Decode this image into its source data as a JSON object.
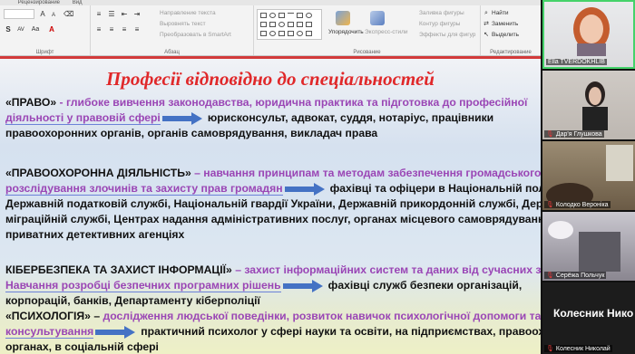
{
  "ribbon": {
    "tabs": [
      "",
      "Рецензирование",
      "Вид"
    ],
    "groups": {
      "font_label": "Шрифт",
      "paragraph_label": "Абзац",
      "drawing_label": "Рисование",
      "editing_label": "Редактирование"
    },
    "paragraph_items": {
      "text_direction": "Направление текста",
      "align_text": "Выровнять текст",
      "smartart": "Преобразовать в SmartArt"
    },
    "drawing_items": {
      "arrange": "Упорядочить",
      "quick_styles": "Экспресс-стили",
      "shape_fill": "Заливка фигуры",
      "shape_outline": "Контур фигуры",
      "shape_effects": "Эффекты для фигур"
    },
    "editing_items": {
      "find": "Найти",
      "replace": "Заменить",
      "select": "Выделить"
    }
  },
  "slide": {
    "title": "Професії відповідно до спеціальностей",
    "sections": [
      {
        "lines": [
          [
            {
              "t": "«ПРАВО»",
              "c": "head"
            },
            {
              "t": " - глибоке вивчення законодавства, юридична практика та підготовка до професійної",
              "c": "purple"
            }
          ],
          [
            {
              "t": "діяльності у правовій сфері",
              "c": "purple uline"
            },
            {
              "arrow": true
            },
            {
              "t": "юрисконсульт, адвокат, суддя, нотаріус, працівники",
              "c": "blk"
            }
          ],
          [
            {
              "t": "правоохоронних органів, органів самоврядування, викладач права",
              "c": "blk"
            }
          ]
        ]
      },
      {
        "lines": [
          [
            {
              "t": "«ПРАВООХОРОННА ДІЯЛЬНІСТЬ»",
              "c": "head"
            },
            {
              "t": " – навчання принципам та методам забезпечення громадського поряд",
              "c": "purple"
            }
          ],
          [
            {
              "t": "розслідування злочинів та захисту прав громадян",
              "c": "purple uline"
            },
            {
              "arrow": true
            },
            {
              "t": "фахівці та офіцери в Національній поліції Украї",
              "c": "blk"
            }
          ],
          [
            {
              "t": "Державній податковій службі, Національній гвардії України, Державній прикордонній службі,  Держав",
              "c": "blk"
            }
          ],
          [
            {
              "t": "міграційній службі, Центрах надання адміністративних послуг, органах місцевого самоврядування,",
              "c": "blk"
            }
          ],
          [
            {
              "t": "приватних детективних агенціях",
              "c": "blk"
            }
          ]
        ]
      },
      {
        "lines": [
          [
            {
              "t": "КІБЕРБЕЗПЕКА ТА ЗАХИСТ ІНФОРМАЦІЇ»",
              "c": "head"
            },
            {
              "t": " – захист інформаційних систем та даних від сучасних загроз.",
              "c": "purple"
            }
          ],
          [
            {
              "t": "Навчання розробці безпечних програмних рішень",
              "c": "purple uline"
            },
            {
              "arrow": true
            },
            {
              "t": "фахівці служб безпеки організацій,",
              "c": "blk"
            }
          ],
          [
            {
              "t": "корпорацій, банків, Департаменту кіберполіції",
              "c": "blk"
            }
          ]
        ]
      },
      {
        "lines": [
          [
            {
              "t": "«ПСИХОЛОГІЯ» –",
              "c": "head"
            },
            {
              "t": "   дослідження людської поведінки, розвиток навичок психологічної допомоги та",
              "c": "purple"
            }
          ],
          [
            {
              "t": "консультування",
              "c": "purple uline"
            },
            {
              "arrow": true
            },
            {
              "t": "практичний психолог у сфері науки та освіти, на підприємствах, правоохоронн",
              "c": "blk"
            }
          ],
          [
            {
              "t": "органах, в соціальній сфері",
              "c": "blk"
            }
          ]
        ]
      }
    ]
  },
  "video": {
    "participants": [
      {
        "name": "Ella TVERDOKHLIB",
        "muted": false,
        "active": true
      },
      {
        "name": "Дар'я Глушкова",
        "muted": true
      },
      {
        "name": "Колодко Вероніка",
        "muted": true
      },
      {
        "name": "Серёжа Польчук",
        "muted": true
      },
      {
        "name": "Колесник Николай",
        "muted": true,
        "big_label": "Колесник  Нико"
      }
    ]
  },
  "colors": {
    "title_red": "#e0282a",
    "purple_text": "#9a46b5",
    "arrow_blue": "#4472c4",
    "active_speaker": "#45d26a"
  }
}
